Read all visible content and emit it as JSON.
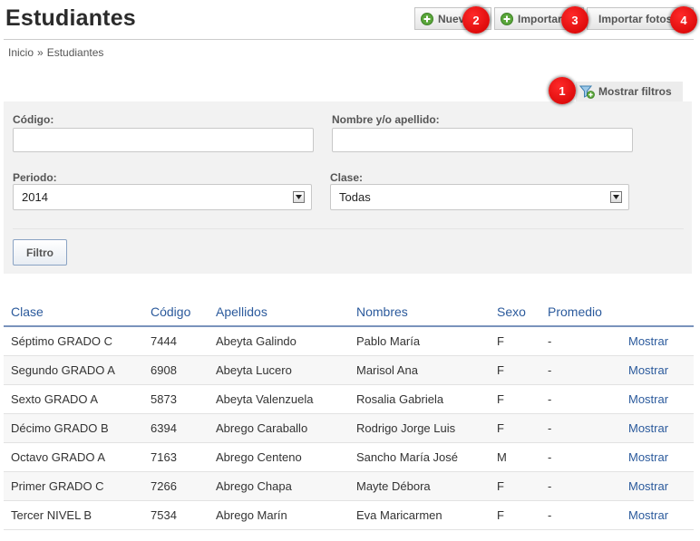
{
  "page": {
    "title": "Estudiantes"
  },
  "breadcrumb": {
    "home": "Inicio",
    "separator": "»",
    "current": "Estudiantes"
  },
  "toolbar": {
    "new_label": "Nuevo",
    "import_label": "Importar",
    "import_photos_label": "Importar fotos",
    "icon": "plus-circle-icon",
    "icon_color": "#5aa63a"
  },
  "callouts": [
    "1",
    "2",
    "3",
    "4"
  ],
  "callout_color": "#d10000",
  "filters": {
    "toggle_label": "Mostrar filtros",
    "toggle_icon": "funnel-filter-icon",
    "code_label": "Código:",
    "code_value": "",
    "name_label": "Nombre y/o apellido:",
    "name_value": "",
    "period_label": "Periodo:",
    "period_value": "2014",
    "class_label": "Clase:",
    "class_value": "Todas",
    "submit_label": "Filtro"
  },
  "table": {
    "columns": [
      "Clase",
      "Código",
      "Apellidos",
      "Nombres",
      "Sexo",
      "Promedio"
    ],
    "link_label": "Mostrar",
    "header_color": "#2b5a9c",
    "rows": [
      {
        "clase": "Séptimo GRADO C",
        "codigo": "7444",
        "apellidos": "Abeyta Galindo",
        "nombres": "Pablo María",
        "sexo": "F",
        "promedio": "-"
      },
      {
        "clase": "Segundo GRADO A",
        "codigo": "6908",
        "apellidos": "Abeyta Lucero",
        "nombres": "Marisol Ana",
        "sexo": "F",
        "promedio": "-"
      },
      {
        "clase": "Sexto GRADO A",
        "codigo": "5873",
        "apellidos": "Abeyta Valenzuela",
        "nombres": "Rosalia Gabriela",
        "sexo": "F",
        "promedio": "-"
      },
      {
        "clase": "Décimo GRADO B",
        "codigo": "6394",
        "apellidos": "Abrego Caraballo",
        "nombres": "Rodrigo Jorge Luis",
        "sexo": "F",
        "promedio": "-"
      },
      {
        "clase": "Octavo GRADO A",
        "codigo": "7163",
        "apellidos": "Abrego Centeno",
        "nombres": "Sancho María José",
        "sexo": "M",
        "promedio": "-"
      },
      {
        "clase": "Primer GRADO C",
        "codigo": "7266",
        "apellidos": "Abrego Chapa",
        "nombres": "Mayte Débora",
        "sexo": "F",
        "promedio": "-"
      },
      {
        "clase": "Tercer NIVEL B",
        "codigo": "7534",
        "apellidos": "Abrego Marín",
        "nombres": "Eva Maricarmen",
        "sexo": "F",
        "promedio": "-"
      }
    ]
  }
}
